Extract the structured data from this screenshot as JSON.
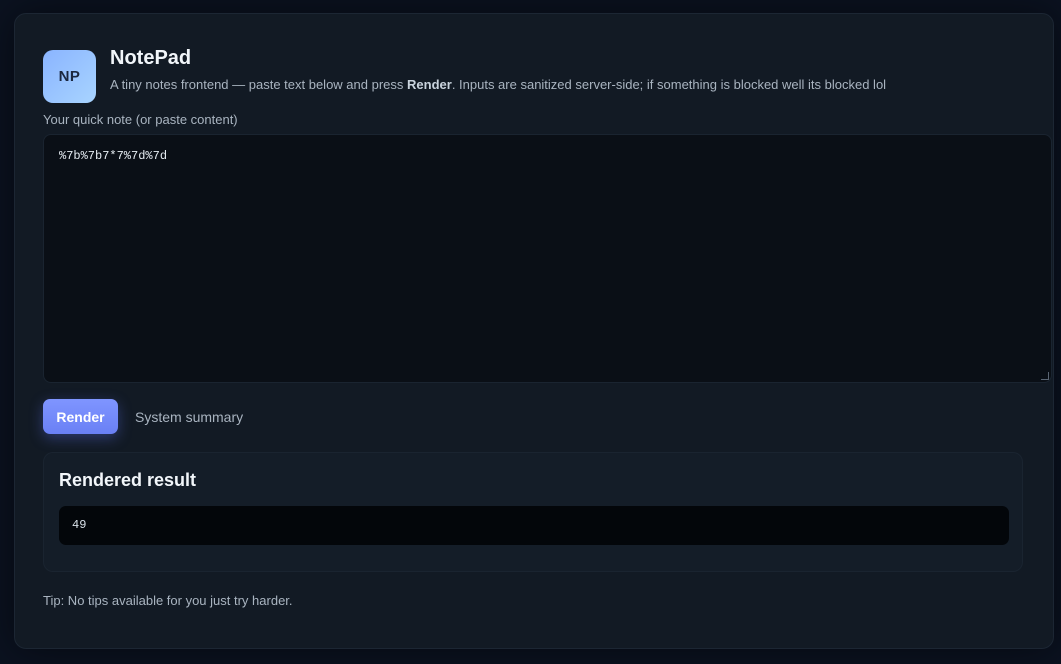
{
  "app": {
    "logo_text": "NP",
    "title": "NotePad",
    "subtitle_pre": "A tiny notes frontend — paste text below and press ",
    "subtitle_bold": "Render",
    "subtitle_post": ". Inputs are sanitized server-side; if something is blocked well its blocked lol"
  },
  "note": {
    "label": "Your quick note (or paste content)",
    "value": "%7b%7b7*7%7d%7d"
  },
  "actions": {
    "render_label": "Render",
    "summary_label": "System summary"
  },
  "result": {
    "title": "Rendered result",
    "output": "49"
  },
  "footer": {
    "tip": "Tip: No tips available for you just try harder."
  },
  "colors": {
    "accent": "#7389ff",
    "background": "#0b1220",
    "panel": "#121a24"
  }
}
